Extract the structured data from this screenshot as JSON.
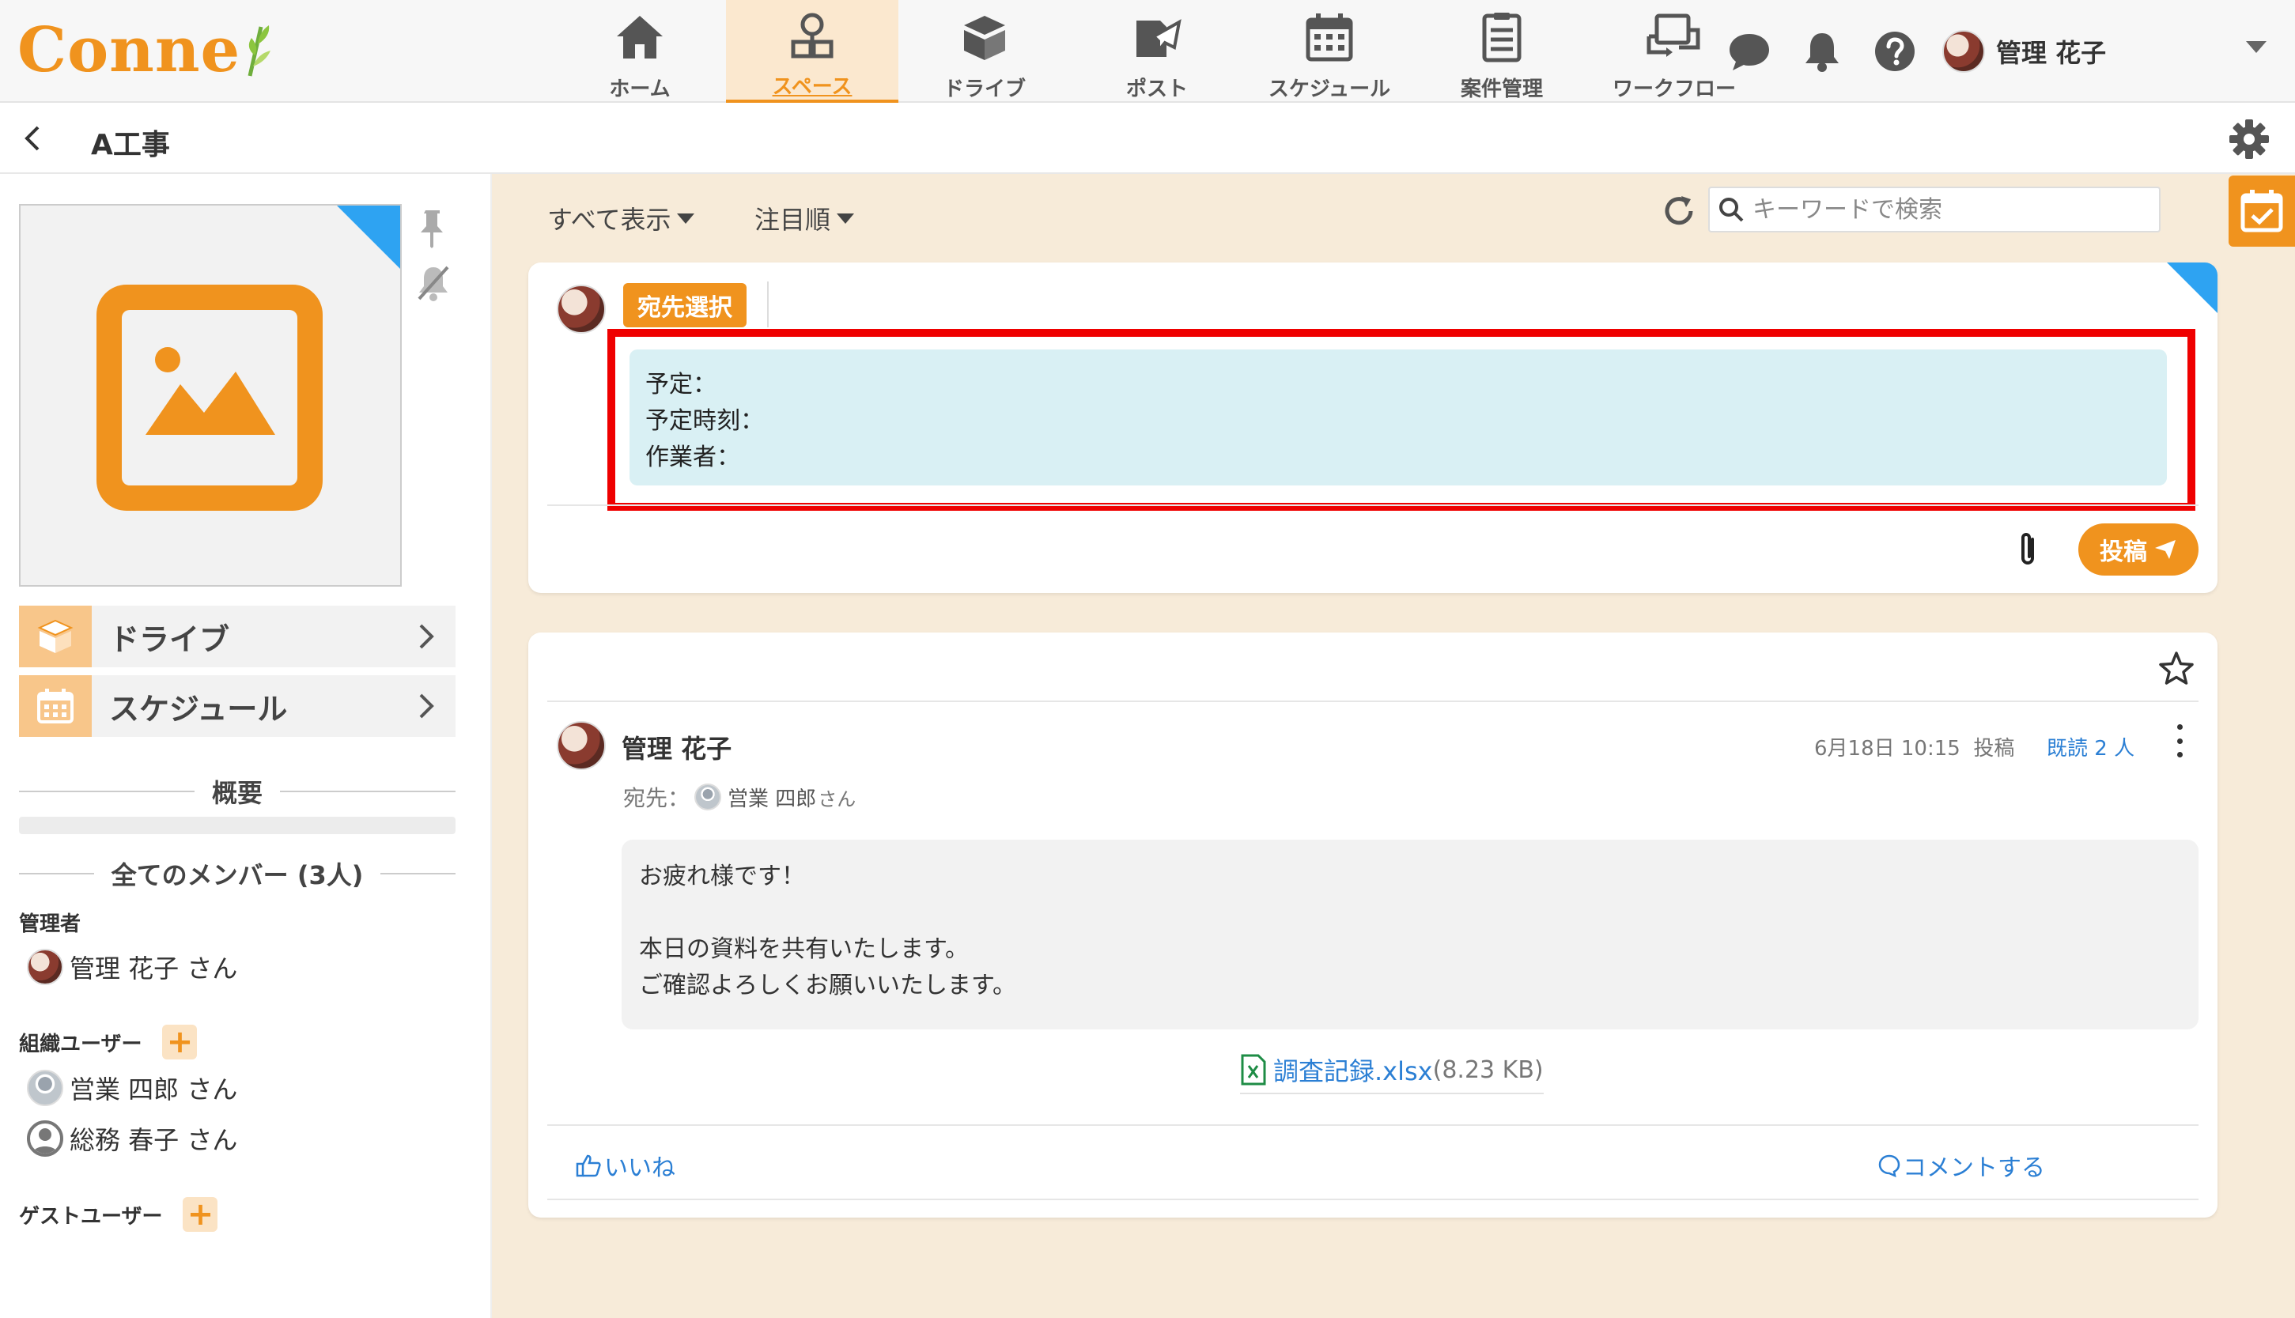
{
  "brand": {
    "logo_text": "Conne",
    "accent": "#f0931e",
    "link": "#2b7fd4",
    "highlight": "#ef0000",
    "template_bg": "#d9f0f4"
  },
  "nav": {
    "items": [
      {
        "label": "ホーム",
        "icon": "home-icon"
      },
      {
        "label": "スペース",
        "icon": "space-icon",
        "active": true
      },
      {
        "label": "ドライブ",
        "icon": "drive-icon"
      },
      {
        "label": "ポスト",
        "icon": "post-icon"
      },
      {
        "label": "スケジュール",
        "icon": "schedule-icon"
      },
      {
        "label": "案件管理",
        "icon": "project-icon"
      },
      {
        "label": "ワークフロー",
        "icon": "workflow-icon"
      }
    ],
    "user_name": "管理 花子"
  },
  "header": {
    "title": "A工事"
  },
  "sidebar": {
    "links": [
      {
        "label": "ドライブ",
        "icon": "drive-icon"
      },
      {
        "label": "スケジュール",
        "icon": "calendar-icon"
      }
    ],
    "overview_label": "概要",
    "members_label": "全てのメンバー (3人)",
    "roles": {
      "admin": "管理者",
      "org_users": "組織ユーザー",
      "guest_users": "ゲストユーザー"
    },
    "members": {
      "admin": [
        {
          "name": "管理 花子 さん"
        }
      ],
      "org": [
        {
          "name": "営業 四郎 さん"
        },
        {
          "name": "総務 春子 さん"
        }
      ]
    }
  },
  "filters": {
    "show_all": "すべて表示",
    "sort": "注目順"
  },
  "search": {
    "placeholder": "キーワードで検索"
  },
  "compose": {
    "address_button": "宛先選択",
    "template_lines": [
      "予定：",
      "予定時刻：",
      "作業者："
    ],
    "post_button": "投稿"
  },
  "post": {
    "author": "管理 花子",
    "datetime": "6月18日 10:15",
    "action": "投稿",
    "read_label": "既読 2 人",
    "to_label": "宛先：",
    "recipient": "営業 四郎",
    "recipient_suffix": "さん",
    "body_lines": [
      "お疲れ様です！",
      "",
      "本日の資料を共有いたします。",
      "ご確認よろしくお願いいたします。"
    ],
    "attachment": {
      "name": "調査記録.xlsx",
      "size": "(8.23 KB)"
    },
    "like_label": "いいね",
    "comment_label": "コメントする"
  }
}
